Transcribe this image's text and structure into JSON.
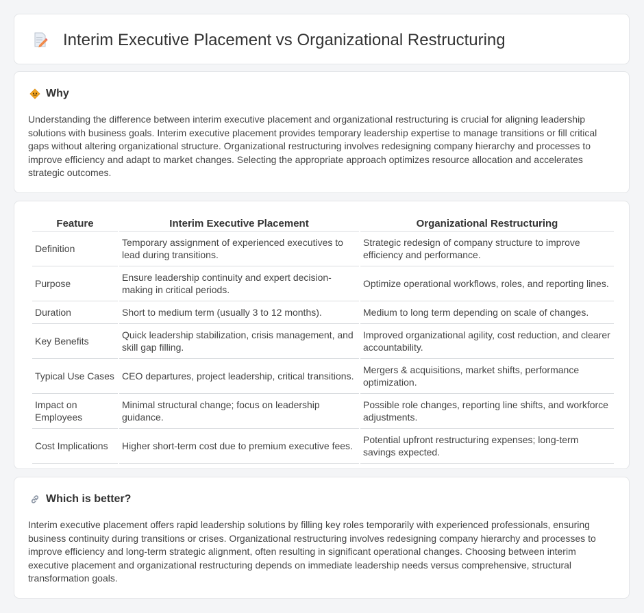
{
  "header": {
    "title": "Interim Executive Placement vs Organizational Restructuring",
    "icon": "document-pencil-icon"
  },
  "why": {
    "heading": "Why",
    "icon": "diamond-sign-icon",
    "text": "Understanding the difference between interim executive placement and organizational restructuring is crucial for aligning leadership solutions with business goals. Interim executive placement provides temporary leadership expertise to manage transitions or fill critical gaps without altering organizational structure. Organizational restructuring involves redesigning company hierarchy and processes to improve efficiency and adapt to market changes. Selecting the appropriate approach optimizes resource allocation and accelerates strategic outcomes."
  },
  "table": {
    "headers": [
      "Feature",
      "Interim Executive Placement",
      "Organizational Restructuring"
    ],
    "rows": [
      [
        "Definition",
        "Temporary assignment of experienced executives to lead during transitions.",
        "Strategic redesign of company structure to improve efficiency and performance."
      ],
      [
        "Purpose",
        "Ensure leadership continuity and expert decision-making in critical periods.",
        "Optimize operational workflows, roles, and reporting lines."
      ],
      [
        "Duration",
        "Short to medium term (usually 3 to 12 months).",
        "Medium to long term depending on scale of changes."
      ],
      [
        "Key Benefits",
        "Quick leadership stabilization, crisis management, and skill gap filling.",
        "Improved organizational agility, cost reduction, and clearer accountability."
      ],
      [
        "Typical Use Cases",
        "CEO departures, project leadership, critical transitions.",
        "Mergers & acquisitions, market shifts, performance optimization."
      ],
      [
        "Impact on Employees",
        "Minimal structural change; focus on leadership guidance.",
        "Possible role changes, reporting line shifts, and workforce adjustments."
      ],
      [
        "Cost Implications",
        "Higher short-term cost due to premium executive fees.",
        "Potential upfront restructuring expenses; long-term savings expected."
      ]
    ]
  },
  "better": {
    "heading": "Which is better?",
    "icon": "link-icon",
    "text": "Interim executive placement offers rapid leadership solutions by filling key roles temporarily with experienced professionals, ensuring business continuity during transitions or crises. Organizational restructuring involves redesigning company hierarchy and processes to improve efficiency and long-term strategic alignment, often resulting in significant operational changes. Choosing between interim executive placement and organizational restructuring depends on immediate leadership needs versus comprehensive, structural transformation goals."
  }
}
